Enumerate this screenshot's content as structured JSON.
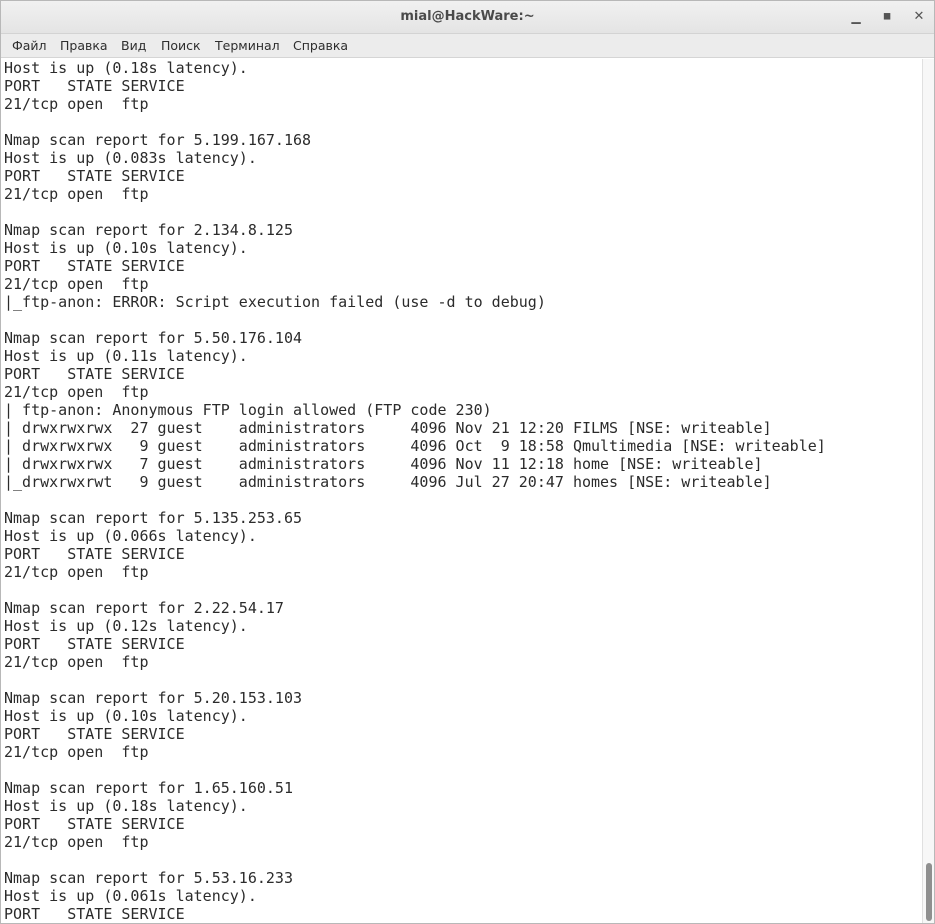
{
  "window": {
    "title": "mial@HackWare:~",
    "controls": {
      "minimize": "▁",
      "maximize": "◼",
      "close": "✕"
    }
  },
  "menu": {
    "items": [
      "Файл",
      "Правка",
      "Вид",
      "Поиск",
      "Терминал",
      "Справка"
    ]
  },
  "terminal": {
    "lines": [
      "Host is up (0.18s latency).",
      "PORT   STATE SERVICE",
      "21/tcp open  ftp",
      "",
      "Nmap scan report for 5.199.167.168",
      "Host is up (0.083s latency).",
      "PORT   STATE SERVICE",
      "21/tcp open  ftp",
      "",
      "Nmap scan report for 2.134.8.125",
      "Host is up (0.10s latency).",
      "PORT   STATE SERVICE",
      "21/tcp open  ftp",
      "|_ftp-anon: ERROR: Script execution failed (use -d to debug)",
      "",
      "Nmap scan report for 5.50.176.104",
      "Host is up (0.11s latency).",
      "PORT   STATE SERVICE",
      "21/tcp open  ftp",
      "| ftp-anon: Anonymous FTP login allowed (FTP code 230)",
      "| drwxrwxrwx  27 guest    administrators     4096 Nov 21 12:20 FILMS [NSE: writeable]",
      "| drwxrwxrwx   9 guest    administrators     4096 Oct  9 18:58 Qmultimedia [NSE: writeable]",
      "| drwxrwxrwx   7 guest    administrators     4096 Nov 11 12:18 home [NSE: writeable]",
      "|_drwxrwxrwt   9 guest    administrators     4096 Jul 27 20:47 homes [NSE: writeable]",
      "",
      "Nmap scan report for 5.135.253.65",
      "Host is up (0.066s latency).",
      "PORT   STATE SERVICE",
      "21/tcp open  ftp",
      "",
      "Nmap scan report for 2.22.54.17",
      "Host is up (0.12s latency).",
      "PORT   STATE SERVICE",
      "21/tcp open  ftp",
      "",
      "Nmap scan report for 5.20.153.103",
      "Host is up (0.10s latency).",
      "PORT   STATE SERVICE",
      "21/tcp open  ftp",
      "",
      "Nmap scan report for 1.65.160.51",
      "Host is up (0.18s latency).",
      "PORT   STATE SERVICE",
      "21/tcp open  ftp",
      "",
      "Nmap scan report for 5.53.16.233",
      "Host is up (0.061s latency).",
      "PORT   STATE SERVICE"
    ]
  },
  "scrollbar": {
    "position": 0.98
  }
}
